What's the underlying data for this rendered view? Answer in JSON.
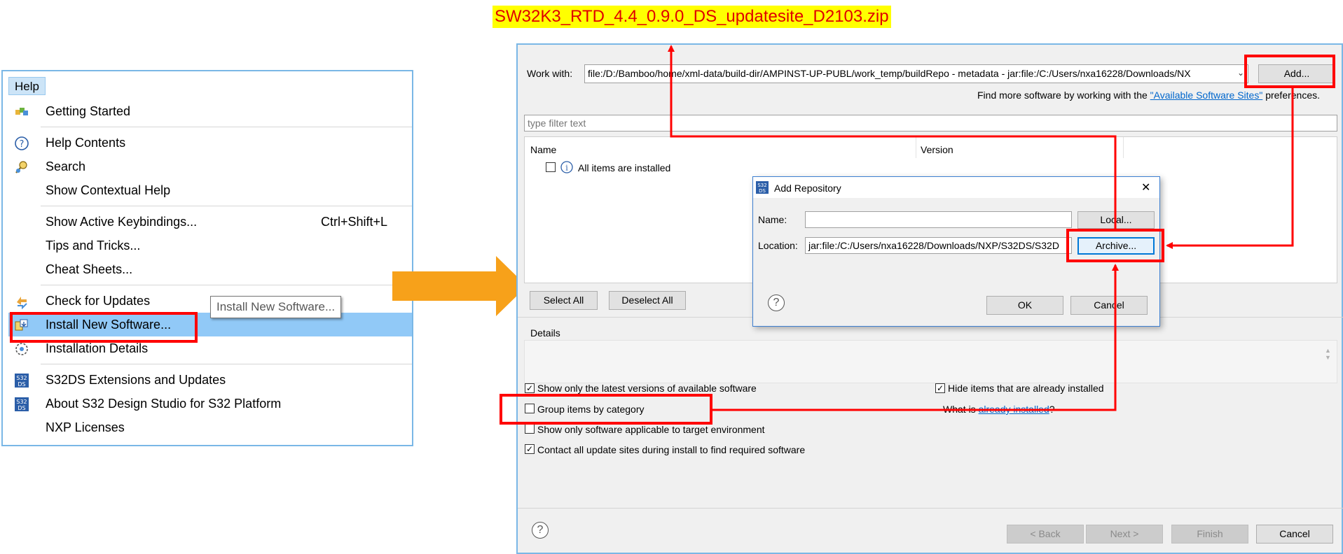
{
  "callout": {
    "filename": "SW32K3_RTD_4.4_0.9.0_DS_updatesite_D2103.zip"
  },
  "help_menu": {
    "title": "Help",
    "items": [
      {
        "label": "Getting Started",
        "icon": "getting-started-icon"
      },
      {
        "label": "Help Contents",
        "icon": "help-contents-icon"
      },
      {
        "label": "Search",
        "icon": "search-icon"
      },
      {
        "label": "Show Contextual Help",
        "icon": ""
      },
      {
        "label": "Show Active Keybindings...",
        "shortcut": "Ctrl+Shift+L"
      },
      {
        "label": "Tips and Tricks..."
      },
      {
        "label": "Cheat Sheets..."
      },
      {
        "label": "Check for Updates",
        "icon": "check-updates-icon"
      },
      {
        "label": "Install New Software...",
        "icon": "install-software-icon",
        "highlighted": true
      },
      {
        "label": "Installation Details",
        "icon": "installation-details-icon"
      },
      {
        "label": "S32DS Extensions and Updates",
        "icon": "s32ds-icon"
      },
      {
        "label": "About S32 Design Studio for S32 Platform",
        "icon": "s32ds-icon"
      },
      {
        "label": "NXP Licenses"
      }
    ],
    "tooltip": "Install New Software..."
  },
  "install_dialog": {
    "work_with_label": "Work with:",
    "work_with_value": "file:/D:/Bamboo/home/xml-data/build-dir/AMPINST-UP-PUBL/work_temp/buildRepo - metadata - jar:file:/C:/Users/nxa16228/Downloads/NX",
    "add_button": "Add...",
    "find_more_prefix": "Find more software by working with the ",
    "find_more_link": "\"Available Software Sites\"",
    "find_more_suffix": " preferences.",
    "filter_placeholder": "type filter text",
    "col_name": "Name",
    "col_version": "Version",
    "row_text": "All items are installed",
    "select_all": "Select All",
    "deselect_all": "Deselect All",
    "details_label": "Details",
    "opt_latest": "Show only the latest versions of available software",
    "opt_group": "Group items by category",
    "opt_applicable": "Show only software applicable to target environment",
    "opt_contact": "Contact all update sites during install to find required software",
    "opt_hide": "Hide items that are already installed",
    "what_is_prefix": "What is ",
    "what_is_link": "already installed",
    "what_is_suffix": "?",
    "back": "< Back",
    "next": "Next >",
    "finish": "Finish",
    "cancel": "Cancel",
    "checks": {
      "latest": true,
      "group": false,
      "applicable": false,
      "contact": true,
      "hide": true
    }
  },
  "add_repository": {
    "icon_text": "S32 DS",
    "title": "Add Repository",
    "close": "✕",
    "name_label": "Name:",
    "name_value": "",
    "local_button": "Local...",
    "location_label": "Location:",
    "location_value": "jar:file:/C:/Users/nxa16228/Downloads/NXP/S32DS/S32D",
    "archive_button": "Archive...",
    "ok": "OK",
    "cancel": "Cancel"
  },
  "colors": {
    "annotation_red": "#ff0000",
    "arrow_orange": "#f7a11a",
    "menu_highlight": "#91c9f7",
    "callout_bg": "#ffff00"
  }
}
